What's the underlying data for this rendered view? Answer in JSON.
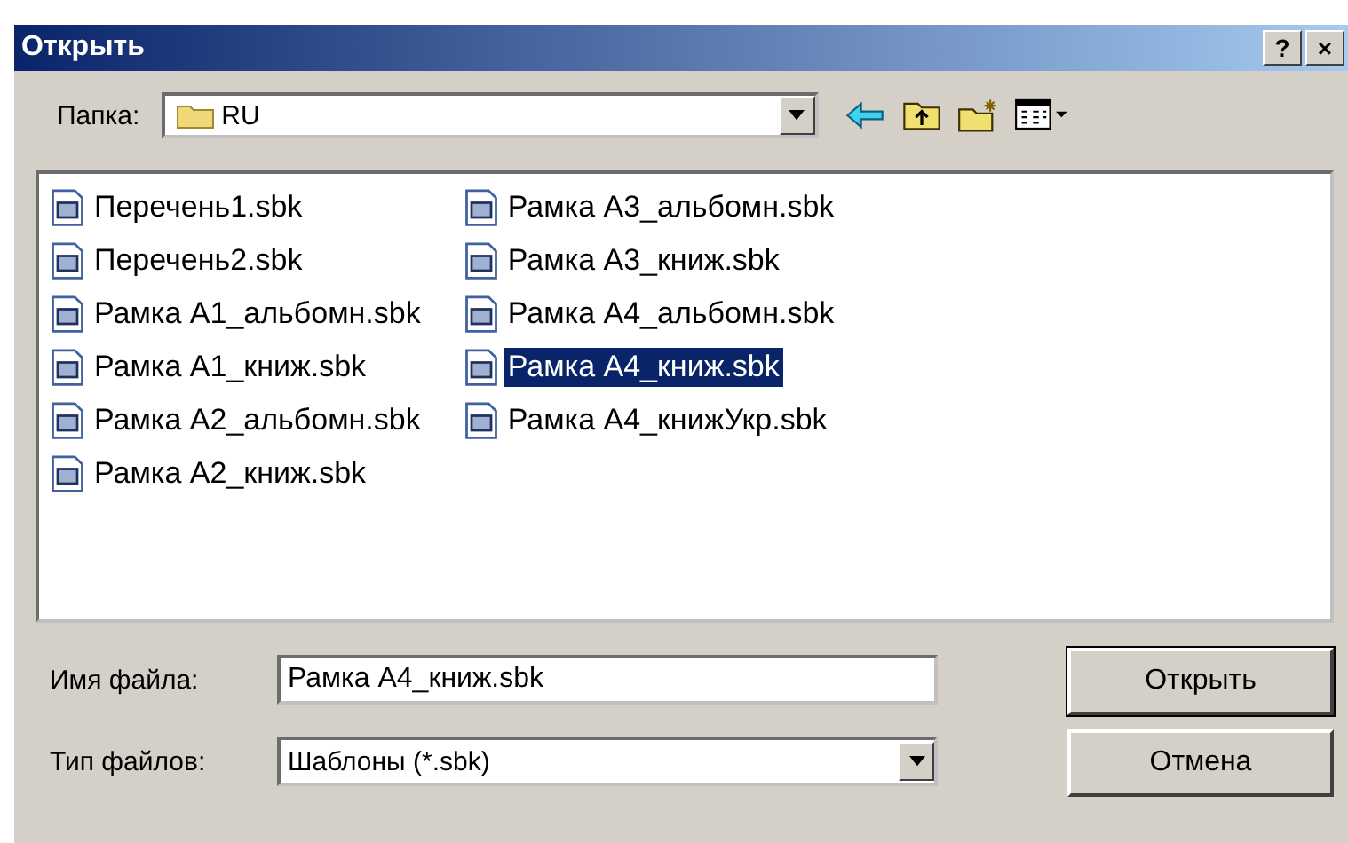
{
  "window": {
    "title": "Открыть",
    "help": "?",
    "close": "×"
  },
  "folder": {
    "label": "Папка:",
    "value": "RU"
  },
  "files": [
    {
      "name": "Перечень1.sbk",
      "selected": false
    },
    {
      "name": "Перечень2.sbk",
      "selected": false
    },
    {
      "name": "Рамка А1_альбомн.sbk",
      "selected": false
    },
    {
      "name": "Рамка А1_книж.sbk",
      "selected": false
    },
    {
      "name": "Рамка А2_альбомн.sbk",
      "selected": false
    },
    {
      "name": "Рамка А2_книж.sbk",
      "selected": false
    },
    {
      "name": "Рамка А3_альбомн.sbk",
      "selected": false
    },
    {
      "name": "Рамка А3_книж.sbk",
      "selected": false
    },
    {
      "name": "Рамка А4_альбомн.sbk",
      "selected": false
    },
    {
      "name": "Рамка А4_книж.sbk",
      "selected": true
    },
    {
      "name": "Рамка А4_книжУкр.sbk",
      "selected": false
    }
  ],
  "filename": {
    "label": "Имя файла:",
    "value": "Рамка А4_книж.sbk"
  },
  "filetype": {
    "label": "Тип файлов:",
    "value": "Шаблоны (*.sbk)"
  },
  "buttons": [
    "Открыть",
    "Отмена"
  ]
}
